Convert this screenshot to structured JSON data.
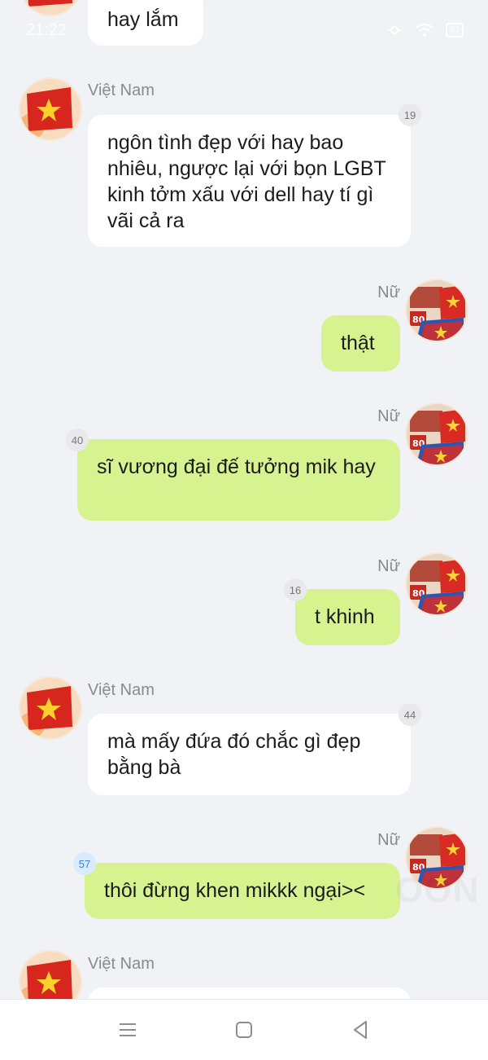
{
  "status_bar": {
    "time": "21:22",
    "battery": "53"
  },
  "messages": [
    {
      "sender": "",
      "text": "hay lắm",
      "count": ""
    },
    {
      "sender": "Việt Nam",
      "text": "ngôn tình đẹp với hay bao nhiêu, ngược lại với bọn LGBT kinh tởm xấu với dell hay tí gì vãi cả ra",
      "count": "19"
    },
    {
      "sender": "Nữ",
      "text": "thật",
      "count": ""
    },
    {
      "sender": "Nữ",
      "text": "sĩ vương đại đế tưởng mik hay",
      "count": "40"
    },
    {
      "sender": "Nữ",
      "text": "t khinh",
      "count": "16"
    },
    {
      "sender": "Việt Nam",
      "text": "mà mấy đứa đó chắc gì đẹp bằng bà",
      "count": "44"
    },
    {
      "sender": "Nữ",
      "text": "thôi đừng khen mikkk ngại><",
      "count": "57"
    },
    {
      "sender": "Việt Nam",
      "text": "",
      "count": ""
    }
  ],
  "watermark": "OON",
  "colors": {
    "background": "#f1f2f6",
    "bubble_other": "#ffffff",
    "bubble_self": "#d6f38f"
  },
  "icons": [
    "wifi-icon",
    "battery-icon",
    "vietnam-flag-avatar",
    "vietnam-80-avatar",
    "menu-icon",
    "home-icon",
    "back-icon"
  ]
}
